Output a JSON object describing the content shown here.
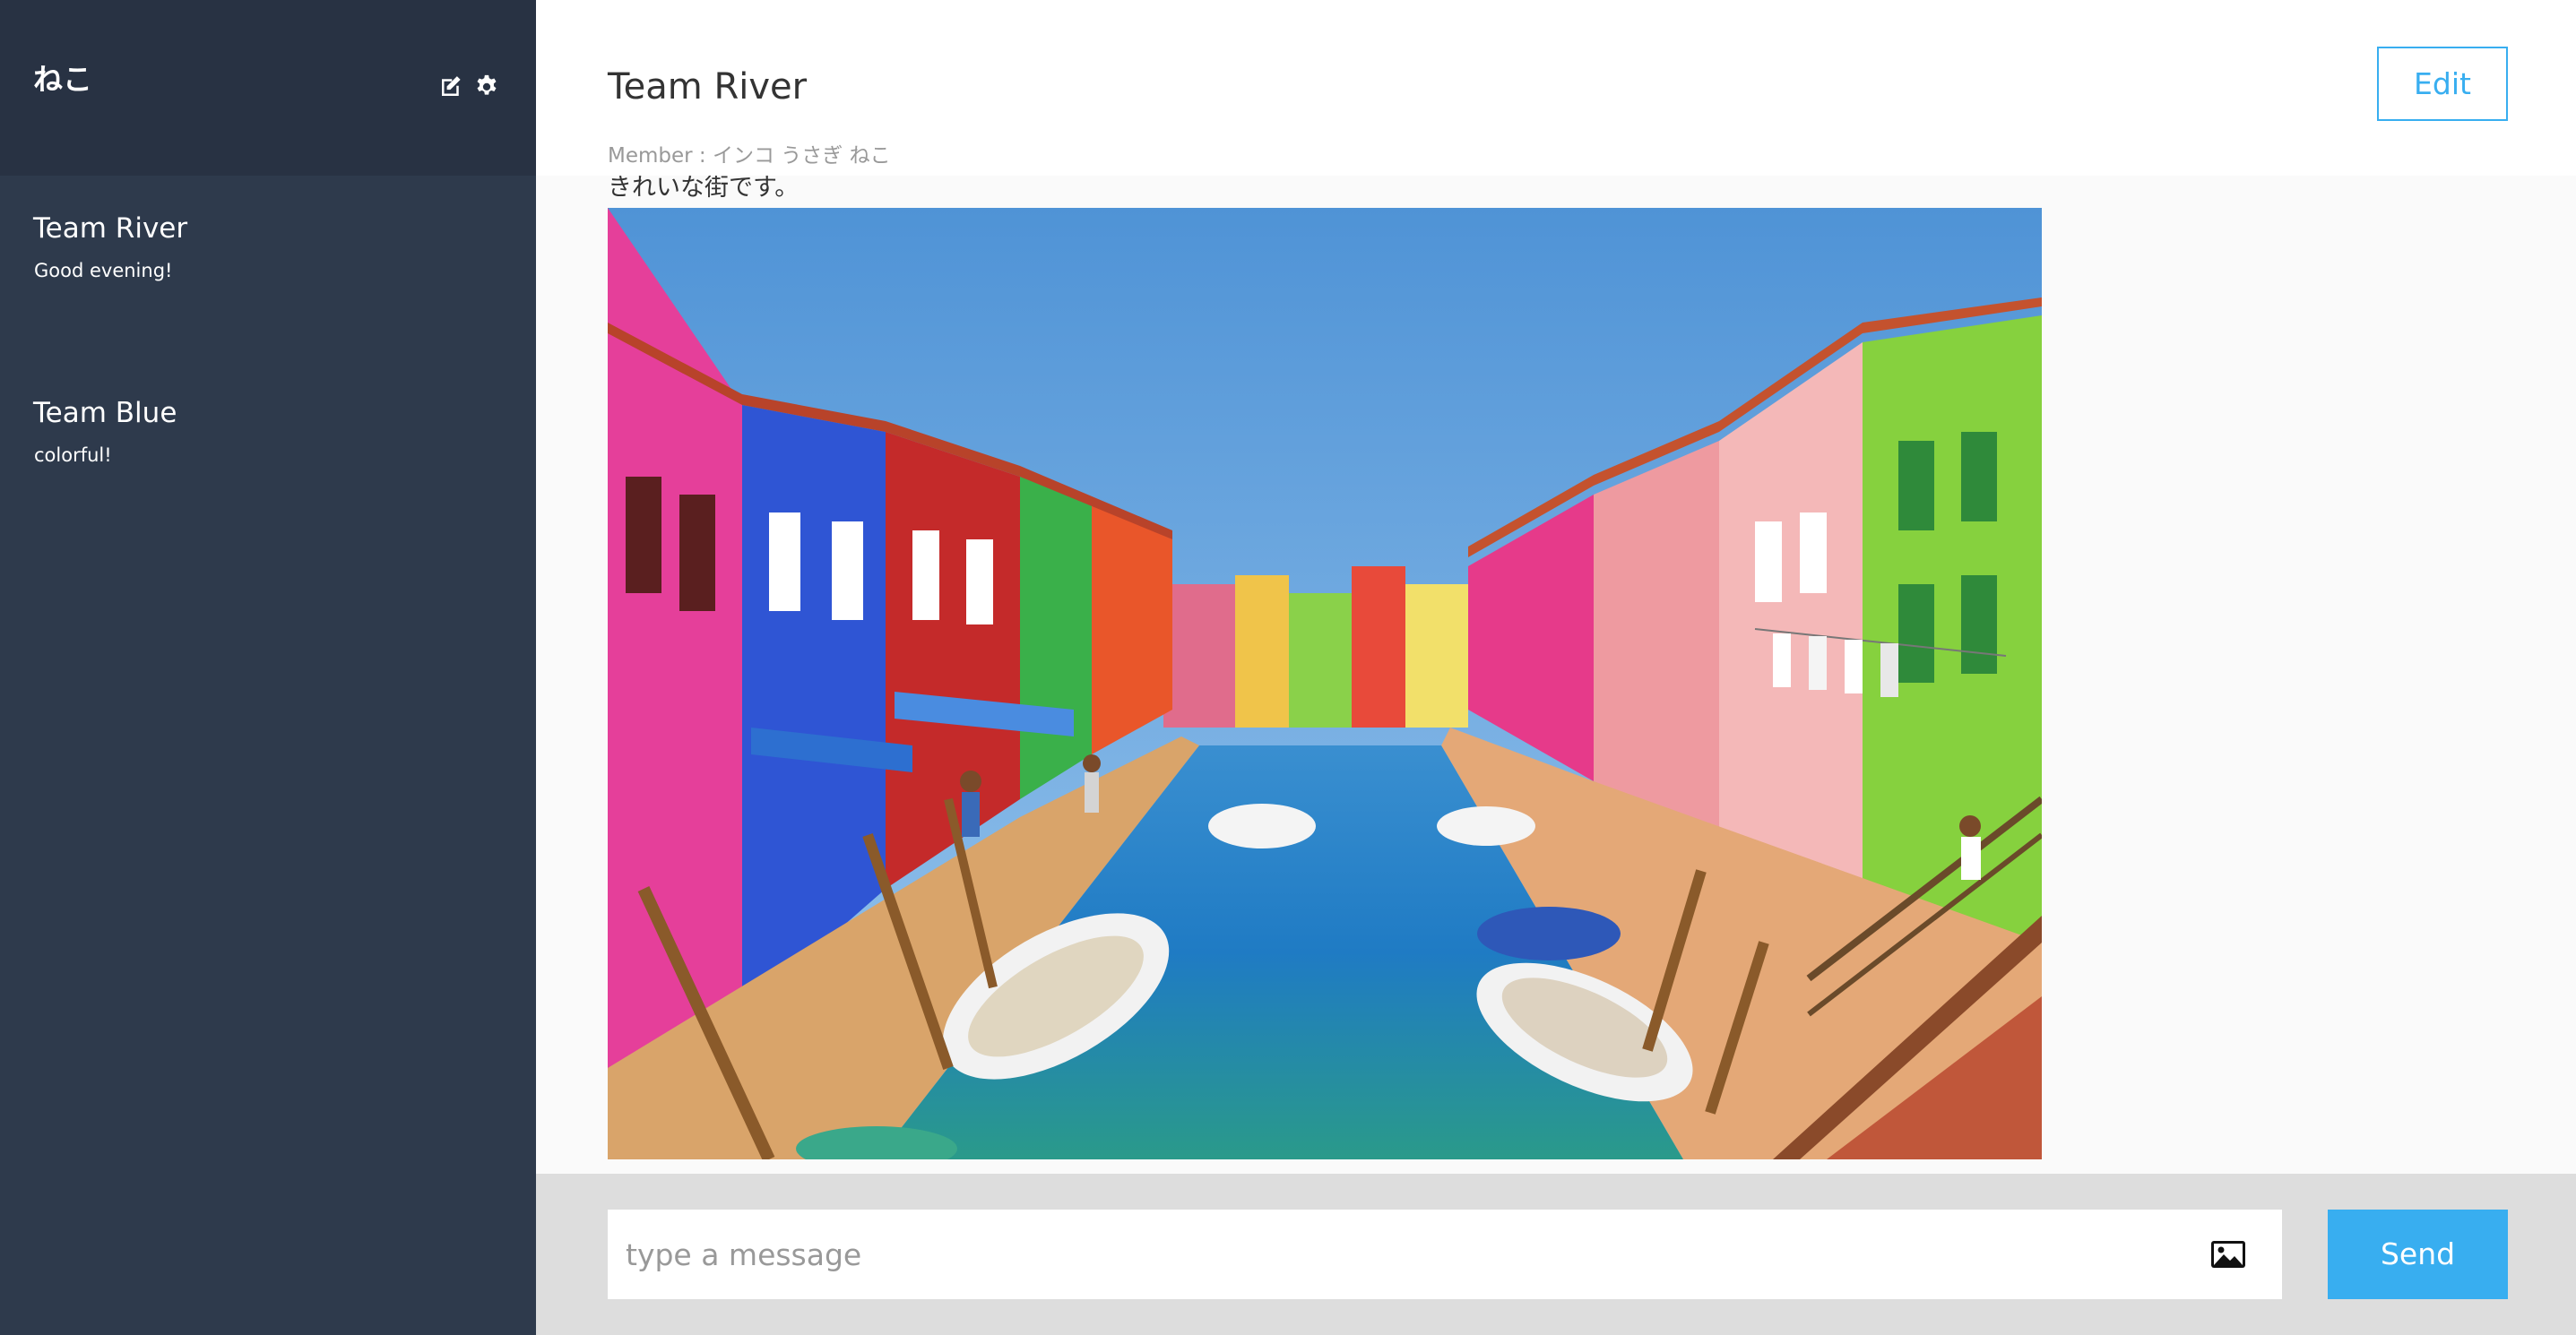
{
  "user": {
    "name": "ねこ"
  },
  "sidebar": {
    "groups": [
      {
        "name": "Team River",
        "last_message": "Good evening!"
      },
      {
        "name": "Team Blue",
        "last_message": "colorful!"
      }
    ],
    "icons": [
      "edit-icon",
      "gear-icon"
    ]
  },
  "chat": {
    "group_name": "Team River",
    "member_line": "Member : インコ うさぎ ねこ",
    "edit_label": "Edit",
    "messages": [
      {
        "text": "きれいな街です。",
        "image": "colorful-canal-town-photo"
      }
    ]
  },
  "form": {
    "placeholder": "type a message",
    "send_label": "Send",
    "image_icon": "image-icon"
  },
  "colors": {
    "sidebar_bg": "#2e3a4c",
    "sidebar_header_bg": "#283243",
    "accent": "#38aef0",
    "form_bg": "#dddddd"
  }
}
